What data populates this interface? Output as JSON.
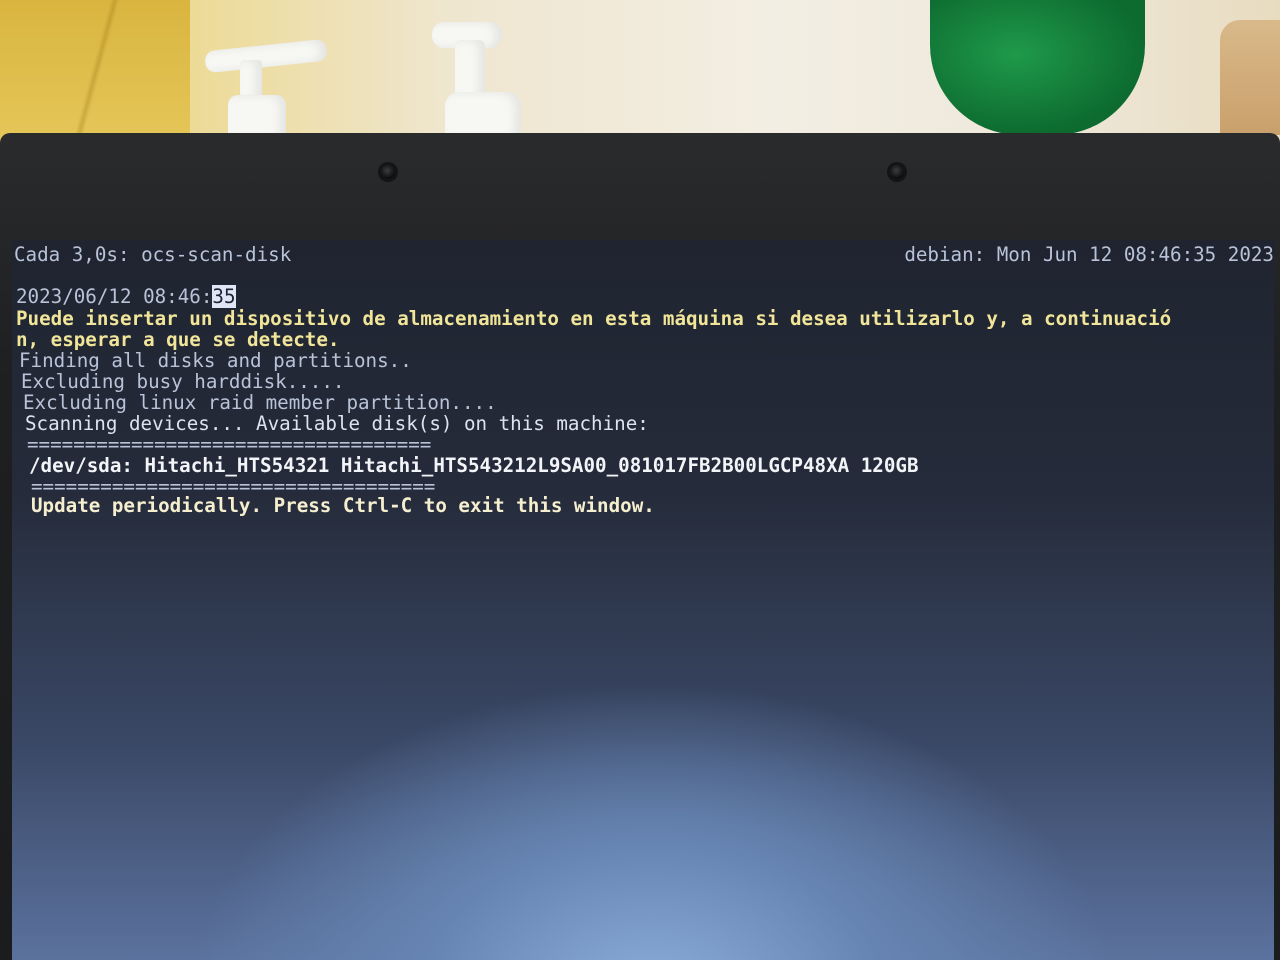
{
  "header": {
    "left": "Cada 3,0s: ocs-scan-disk",
    "right": "debian: Mon Jun 12 08:46:35 2023"
  },
  "output": {
    "timestamp_main": "2023/06/12 08:46:",
    "timestamp_cursor": "35",
    "msg_line1": "Puede insertar un dispositivo de almacenamiento en esta máquina si desea utilizarlo y, a continuació",
    "msg_line2": "n, esperar a que se detecte.",
    "finding": "Finding all disks and partitions..",
    "excluding_busy": "Excluding busy harddisk.....",
    "excluding_raid": "Excluding linux raid member partition....",
    "scanning": "Scanning devices... Available disk(s) on this machine:",
    "separator_top": "===================================",
    "disk_entry": "/dev/sda: Hitachi_HTS54321 Hitachi_HTS543212L9SA00_081017FB2B00LGCP48XA 120GB",
    "separator_bottom": "===================================",
    "update_hint": "Update periodically. Press Ctrl-C to exit this window."
  },
  "colors": {
    "terminal_text": "#b9c3d8",
    "warning_text": "#f1e59a",
    "bezel": "#1e1f21"
  },
  "icons": [
    "webcam-icon",
    "webcam-icon"
  ]
}
